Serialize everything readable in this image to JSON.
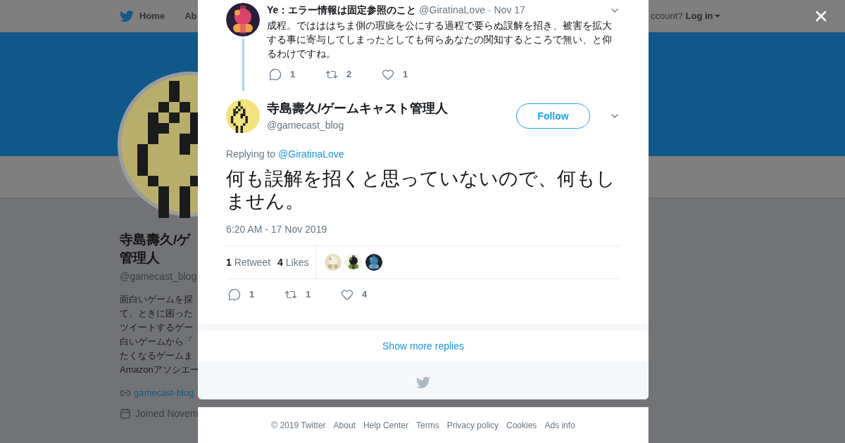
{
  "background_page": {
    "nav": {
      "items": [
        {
          "label": "Home",
          "kind": "home"
        },
        {
          "label": "Ab",
          "kind": "plain"
        }
      ],
      "account_prompt": "ccount?",
      "login": "Log in"
    },
    "profile": {
      "name_lines": [
        "寺島壽久/ゲ",
        "管理人"
      ],
      "handle": "@gamecast_blog",
      "bio_lines": [
        "面白いゲームを探",
        "て、ときに困った",
        "ツイートするゲー",
        "白いゲームから「",
        "たくなるゲームま",
        "Amazonアソシエー"
      ],
      "link": "gamecast-blog",
      "joined": "Joined Novem"
    }
  },
  "modal": {
    "parent_tweet": {
      "name": "Ye：エラー情報は固定参照のこと",
      "handle": "@GiratinaLove",
      "time": "· Nov 17",
      "text": "成程。ではははちま側の瑕疵を公にする過程で要らぬ誤解を招き、被害を拡大する事に寄与してしまったとしても何らあなたの関知するところで無い、と仰るわけですね。",
      "actions": [
        {
          "kind": "reply",
          "count": "1"
        },
        {
          "kind": "retweet",
          "count": "2"
        },
        {
          "kind": "like",
          "count": "1"
        }
      ]
    },
    "main_tweet": {
      "name": "寺島壽久/ゲームキャスト管理人",
      "handle": "@gamecast_blog",
      "follow_button": "Follow",
      "replying_label": "Replying to",
      "reply_to": "@GiratinaLove",
      "text": "何も誤解を招くと思っていないので、何もしません。",
      "timestamp": "6:20 AM - 17 Nov 2019",
      "stats": [
        {
          "count": "1",
          "label": "Retweet"
        },
        {
          "count": "4",
          "label": "Likes"
        }
      ],
      "actions": [
        {
          "kind": "reply",
          "count": "1"
        },
        {
          "kind": "retweet",
          "count": "1"
        },
        {
          "kind": "like",
          "count": "4"
        }
      ]
    },
    "show_more": "Show more replies"
  },
  "footer": {
    "links": [
      "© 2019 Twitter",
      "About",
      "Help Center",
      "Terms",
      "Privacy policy",
      "Cookies",
      "Ads info"
    ]
  }
}
